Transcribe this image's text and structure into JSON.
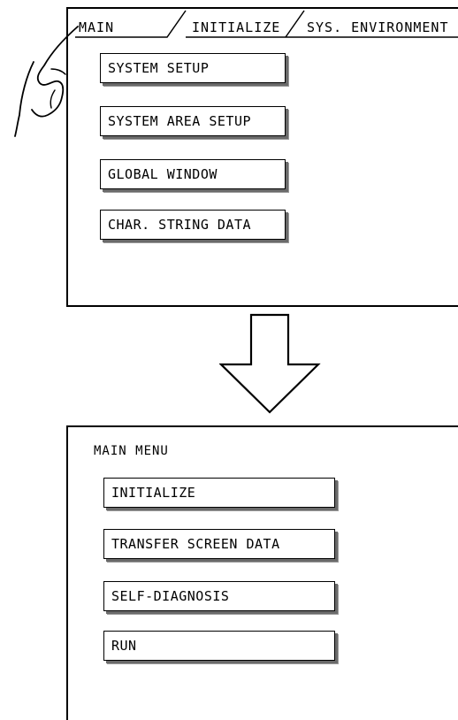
{
  "top_panel": {
    "tabs": [
      {
        "label": "MAIN"
      },
      {
        "label": "INITIALIZE"
      },
      {
        "label": "SYS. ENVIRONMENT"
      }
    ],
    "buttons": [
      {
        "label": "SYSTEM SETUP"
      },
      {
        "label": "SYSTEM AREA SETUP"
      },
      {
        "label": "GLOBAL WINDOW"
      },
      {
        "label": "CHAR. STRING DATA"
      }
    ]
  },
  "bottom_panel": {
    "title": "MAIN MENU",
    "buttons": [
      {
        "label": "INITIALIZE"
      },
      {
        "label": "TRANSFER SCREEN DATA"
      },
      {
        "label": "SELF-DIAGNOSIS"
      },
      {
        "label": "RUN"
      }
    ]
  },
  "icons": {
    "pointer": "pointing-hand-icon",
    "transition": "down-arrow-icon"
  }
}
